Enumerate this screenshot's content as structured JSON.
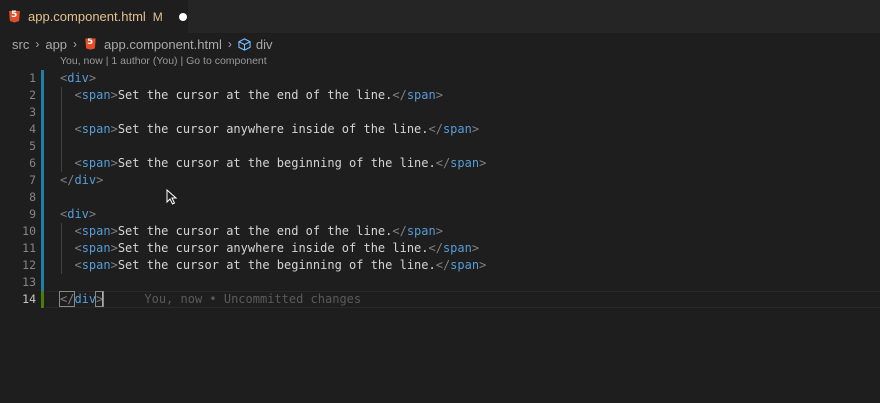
{
  "tab": {
    "title": "app.component.html",
    "status": "M",
    "icon": "html5-icon"
  },
  "breadcrumb": {
    "items": [
      "src",
      "app",
      "app.component.html",
      "div"
    ]
  },
  "codelens": {
    "author_info": "You, now | 1 author (You)",
    "separator": " | ",
    "go_to_component": "Go to component"
  },
  "editor": {
    "lines": [
      {
        "n": "1",
        "parts": [
          [
            "punc",
            "<"
          ],
          [
            "tag",
            "div"
          ],
          [
            "punc",
            ">"
          ]
        ]
      },
      {
        "n": "2",
        "parts": [
          [
            "txt",
            "  "
          ],
          [
            "punc",
            "<"
          ],
          [
            "tag",
            "span"
          ],
          [
            "punc",
            ">"
          ],
          [
            "txt",
            "Set the cursor at the end of the line."
          ],
          [
            "punc",
            "</"
          ],
          [
            "tag",
            "span"
          ],
          [
            "punc",
            ">"
          ]
        ]
      },
      {
        "n": "3",
        "parts": []
      },
      {
        "n": "4",
        "parts": [
          [
            "txt",
            "  "
          ],
          [
            "punc",
            "<"
          ],
          [
            "tag",
            "span"
          ],
          [
            "punc",
            ">"
          ],
          [
            "txt",
            "Set the cursor anywhere inside of the line."
          ],
          [
            "punc",
            "</"
          ],
          [
            "tag",
            "span"
          ],
          [
            "punc",
            ">"
          ]
        ]
      },
      {
        "n": "5",
        "parts": []
      },
      {
        "n": "6",
        "parts": [
          [
            "txt",
            "  "
          ],
          [
            "punc",
            "<"
          ],
          [
            "tag",
            "span"
          ],
          [
            "punc",
            ">"
          ],
          [
            "txt",
            "Set the cursor at the beginning of the line."
          ],
          [
            "punc",
            "</"
          ],
          [
            "tag",
            "span"
          ],
          [
            "punc",
            ">"
          ]
        ]
      },
      {
        "n": "7",
        "parts": [
          [
            "punc",
            "</"
          ],
          [
            "tag",
            "div"
          ],
          [
            "punc",
            ">"
          ]
        ]
      },
      {
        "n": "8",
        "parts": []
      },
      {
        "n": "9",
        "parts": [
          [
            "punc",
            "<"
          ],
          [
            "tag",
            "div"
          ],
          [
            "punc",
            ">"
          ]
        ]
      },
      {
        "n": "10",
        "parts": [
          [
            "txt",
            "  "
          ],
          [
            "punc",
            "<"
          ],
          [
            "tag",
            "span"
          ],
          [
            "punc",
            ">"
          ],
          [
            "txt",
            "Set the cursor at the end of the line."
          ],
          [
            "punc",
            "</"
          ],
          [
            "tag",
            "span"
          ],
          [
            "punc",
            ">"
          ]
        ]
      },
      {
        "n": "11",
        "parts": [
          [
            "txt",
            "  "
          ],
          [
            "punc",
            "<"
          ],
          [
            "tag",
            "span"
          ],
          [
            "punc",
            ">"
          ],
          [
            "txt",
            "Set the cursor anywhere inside of the line."
          ],
          [
            "punc",
            "</"
          ],
          [
            "tag",
            "span"
          ],
          [
            "punc",
            ">"
          ]
        ]
      },
      {
        "n": "12",
        "parts": [
          [
            "txt",
            "  "
          ],
          [
            "punc",
            "<"
          ],
          [
            "tag",
            "span"
          ],
          [
            "punc",
            ">"
          ],
          [
            "txt",
            "Set the cursor at the beginning of the line."
          ],
          [
            "punc",
            "</"
          ],
          [
            "tag",
            "span"
          ],
          [
            "punc",
            ">"
          ]
        ]
      },
      {
        "n": "13",
        "parts": []
      },
      {
        "n": "14",
        "parts": [
          [
            "punc",
            "</"
          ],
          [
            "tag",
            "div"
          ],
          [
            "punc",
            ">"
          ]
        ]
      }
    ],
    "active_line": "14",
    "blame_text": "You, now • Uncommitted changes"
  },
  "colors": {
    "background": "#1e1e1e",
    "tag": "#569cd6",
    "modified_tab_text": "#e2c08d",
    "gutter_modified": "#1b81a8",
    "gutter_added": "#487e02"
  }
}
